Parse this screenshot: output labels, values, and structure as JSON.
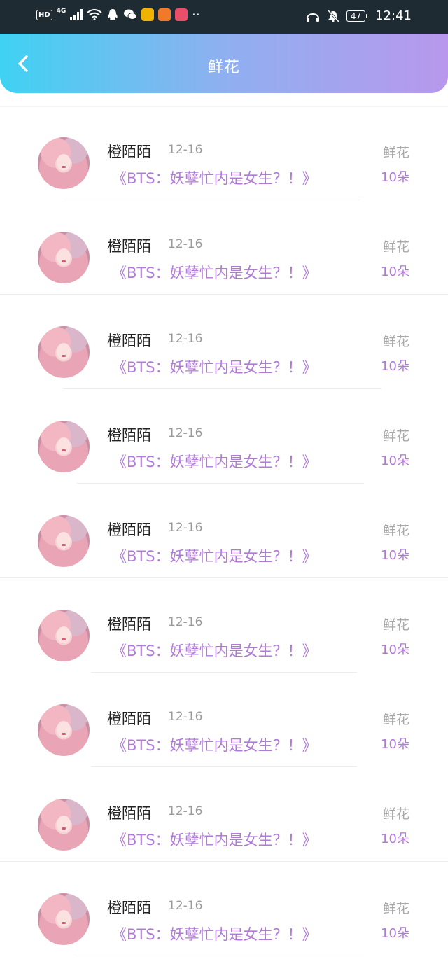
{
  "status_bar": {
    "hd": "HD",
    "signal": "4G",
    "battery": "47",
    "time": "12:41",
    "app_icons": [
      {
        "name": "wechat-icon",
        "color": "#ffffff"
      },
      {
        "name": "weibo-icon",
        "color": "#f0b400"
      },
      {
        "name": "health-icon",
        "color": "#f07a2a"
      },
      {
        "name": "reader-icon",
        "color": "#e94f6a"
      }
    ]
  },
  "header": {
    "title": "鲜花",
    "gradient": [
      "#3fd2f2",
      "#b898ec"
    ]
  },
  "colors": {
    "accent": "#b07ad8",
    "name": "#222222",
    "muted": "#a8a8a8"
  },
  "items": [
    {
      "name": "橙陌陌",
      "date": "12-16",
      "book": "《BTS：妖孽忙内是女生？！》",
      "gift": "鲜花",
      "count": "10朵"
    },
    {
      "name": "橙陌陌",
      "date": "12-16",
      "book": "《BTS：妖孽忙内是女生？！》",
      "gift": "鲜花",
      "count": "10朵"
    },
    {
      "name": "橙陌陌",
      "date": "12-16",
      "book": "《BTS：妖孽忙内是女生？！》",
      "gift": "鲜花",
      "count": "10朵"
    },
    {
      "name": "橙陌陌",
      "date": "12-16",
      "book": "《BTS：妖孽忙内是女生？！》",
      "gift": "鲜花",
      "count": "10朵"
    },
    {
      "name": "橙陌陌",
      "date": "12-16",
      "book": "《BTS：妖孽忙内是女生？！》",
      "gift": "鲜花",
      "count": "10朵"
    },
    {
      "name": "橙陌陌",
      "date": "12-16",
      "book": "《BTS：妖孽忙内是女生？！》",
      "gift": "鲜花",
      "count": "10朵"
    },
    {
      "name": "橙陌陌",
      "date": "12-16",
      "book": "《BTS：妖孽忙内是女生？！》",
      "gift": "鲜花",
      "count": "10朵"
    },
    {
      "name": "橙陌陌",
      "date": "12-16",
      "book": "《BTS：妖孽忙内是女生？！》",
      "gift": "鲜花",
      "count": "10朵"
    },
    {
      "name": "橙陌陌",
      "date": "12-16",
      "book": "《BTS：妖孽忙内是女生？！》",
      "gift": "鲜花",
      "count": "10朵"
    }
  ]
}
